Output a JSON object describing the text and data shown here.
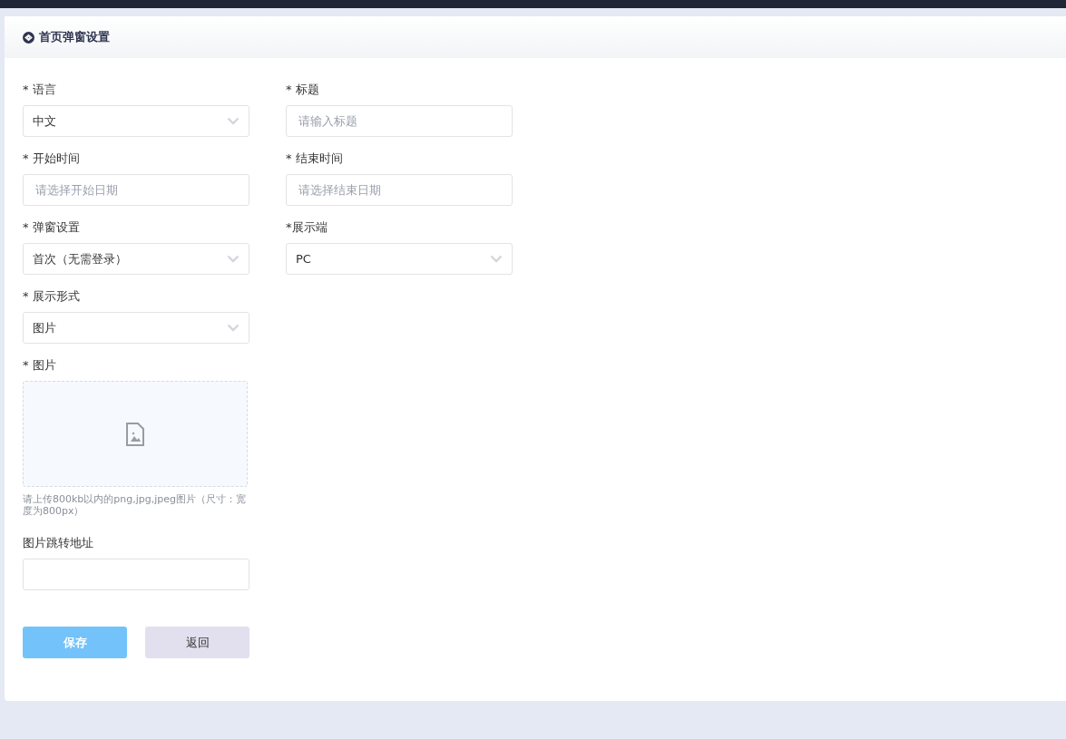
{
  "card": {
    "title": "首页弹窗设置"
  },
  "rows": [
    [
      {
        "label": "* 语言",
        "kind": "select",
        "value": "中文"
      },
      {
        "label": "* 标题",
        "kind": "input",
        "placeholder": "请输入标题"
      }
    ],
    [
      {
        "label": "* 开始时间",
        "kind": "input",
        "placeholder": "请选择开始日期"
      },
      {
        "label": "* 结束时间",
        "kind": "input",
        "placeholder": "请选择结束日期"
      }
    ],
    [
      {
        "label": "* 弹窗设置",
        "kind": "select",
        "value": "首次（无需登录）"
      },
      {
        "label": "*展示端",
        "kind": "select",
        "value": "PC"
      }
    ],
    [
      {
        "label": "* 展示形式",
        "kind": "select",
        "value": "图片"
      }
    ]
  ],
  "upload": {
    "label": "* 图片",
    "hint": "请上传800kb以内的png,jpg,jpeg图片（尺寸：宽度为800px）"
  },
  "link_field": {
    "label": "图片跳转地址"
  },
  "buttons": [
    {
      "label": "保存",
      "kind": "primary"
    },
    {
      "label": "返回",
      "kind": "secondary"
    }
  ]
}
